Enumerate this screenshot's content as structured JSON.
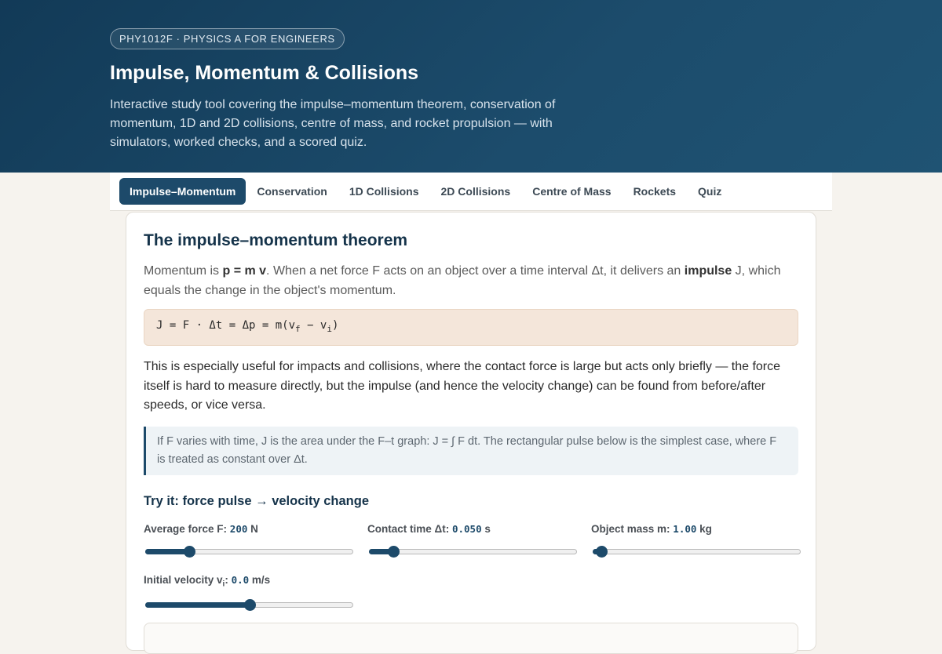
{
  "header": {
    "course_badge": "PHY1012F · PHYSICS A FOR ENGINEERS",
    "title": "Impulse, Momentum & Collisions",
    "subtitle": "Interactive study tool covering the impulse–momentum theorem, conservation of momentum, 1D and 2D collisions, centre of mass, and rocket propulsion — with simulators, worked checks, and a scored quiz."
  },
  "tabs": [
    {
      "label": "Impulse–Momentum",
      "active": true
    },
    {
      "label": "Conservation",
      "active": false
    },
    {
      "label": "1D Collisions",
      "active": false
    },
    {
      "label": "2D Collisions",
      "active": false
    },
    {
      "label": "Centre of Mass",
      "active": false
    },
    {
      "label": "Rockets",
      "active": false
    },
    {
      "label": "Quiz",
      "active": false
    }
  ],
  "section": {
    "title": "The impulse–momentum theorem",
    "lead_1": "Momentum is ",
    "lead_p_eq": "p = m v",
    "lead_2": ". When a net force F acts on an object over a time interval Δt, it delivers an ",
    "lead_impulse": "impulse",
    "lead_3": " J, which equals the change in the object's momentum.",
    "formula_main": "J = F · Δt = Δp = m(v",
    "formula_sub_f": "f",
    "formula_minus": " − v",
    "formula_sub_i": "i",
    "formula_close": ")",
    "body": "This is especially useful for impacts and collisions, where the contact force is large but acts only briefly — the force itself is hard to measure directly, but the impulse (and hence the velocity change) can be found from before/after speeds, or vice versa.",
    "note": "If F varies with time, J is the area under the F–t graph: J = ∫ F dt. The rectangular pulse below is the simplest case, where F is treated as constant over Δt."
  },
  "simulator": {
    "title": "Try it: force pulse → velocity change",
    "controls": [
      {
        "label": "Average force F: ",
        "value": "200",
        "unit": " N",
        "fraction": 0.212
      },
      {
        "label": "Contact time Δt: ",
        "value": "0.050",
        "unit": " s",
        "fraction": 0.118
      },
      {
        "label": "Object mass m: ",
        "value": "1.00",
        "unit": " kg",
        "fraction": 0.04
      },
      {
        "label_pre": "Initial velocity v",
        "label_sub": "i",
        "label_post": ": ",
        "value": "0.0",
        "unit": " m/s",
        "fraction": 0.5
      }
    ]
  },
  "colors": {
    "accent": "#1d4a6a",
    "hero_bg": "#123a57",
    "formula_bg": "#f4e6da",
    "note_bg": "#eef3f6"
  }
}
